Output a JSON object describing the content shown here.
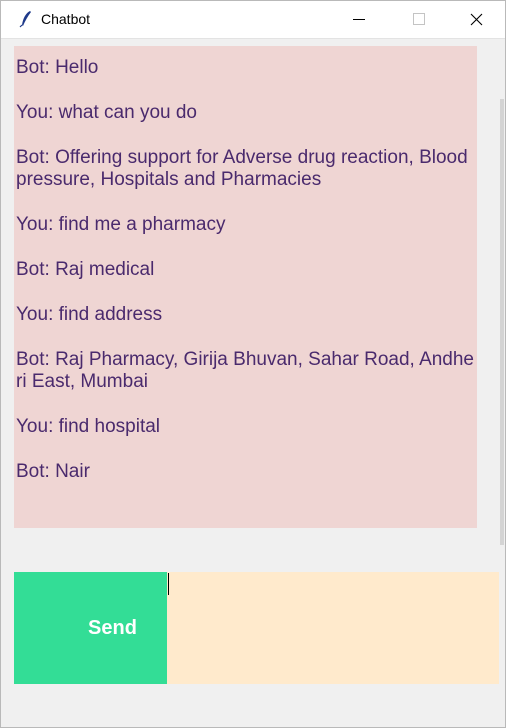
{
  "window": {
    "title": "Chatbot",
    "minimize_glyph": "—",
    "maximize_glyph": "□",
    "close_glyph": "✕",
    "app_icon": "feather-icon"
  },
  "chat": {
    "messages": [
      "Bot: Hello",
      "You: what can you do",
      "Bot: Offering support for Adverse drug reaction, Blood pressure, Hospitals and Pharmacies",
      "You: find me a pharmacy",
      "Bot: Raj medical",
      "You: find address",
      "Bot: Raj Pharmacy, Girija Bhuvan, Sahar Road, Andheri East, Mumbai",
      "You: find hospital",
      "Bot: Nair"
    ]
  },
  "composer": {
    "send_label": "Send",
    "input_value": ""
  },
  "colors": {
    "chat_bg": "#efd5d3",
    "chat_text": "#4a2a6d",
    "send_bg": "#33dd96",
    "input_bg": "#ffeacc",
    "window_bg": "#f0f0f0"
  }
}
